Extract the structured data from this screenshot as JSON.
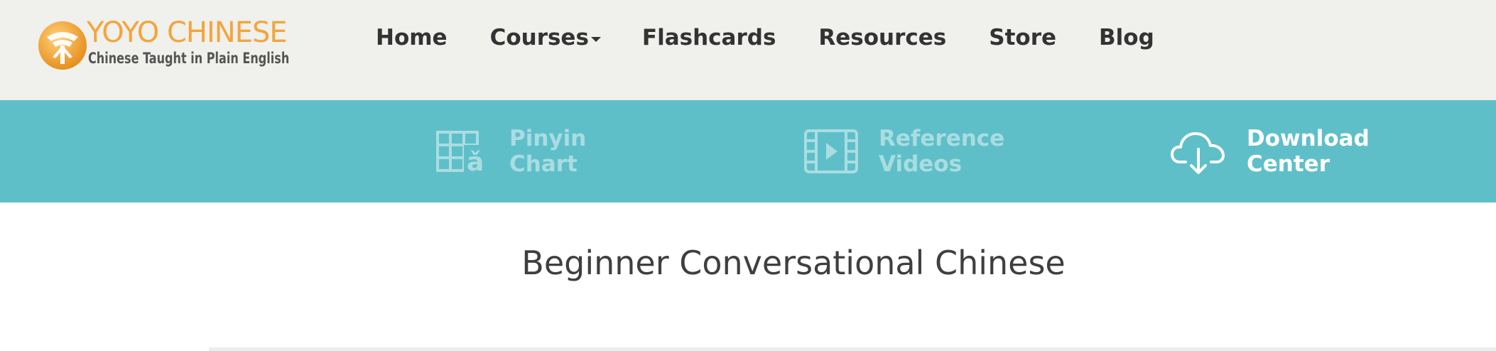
{
  "brand": {
    "name": "YOYO CHINESE",
    "tagline": "Chinese Taught in Plain English",
    "color": "#f3a53b"
  },
  "nav": {
    "items": [
      {
        "label": "Home"
      },
      {
        "label": "Courses",
        "has_dropdown": true
      },
      {
        "label": "Flashcards"
      },
      {
        "label": "Resources"
      },
      {
        "label": "Store"
      },
      {
        "label": "Blog"
      }
    ]
  },
  "resources_bar": {
    "background": "#5fbfc9",
    "items": [
      {
        "line1": "Pinyin",
        "line2": "Chart",
        "icon": "pinyin-chart-icon",
        "active": false
      },
      {
        "line1": "Reference",
        "line2": "Videos",
        "icon": "video-film-icon",
        "active": false
      },
      {
        "line1": "Download",
        "line2": "Center",
        "icon": "cloud-download-icon",
        "active": true
      }
    ]
  },
  "page": {
    "title": "Beginner Conversational Chinese"
  }
}
